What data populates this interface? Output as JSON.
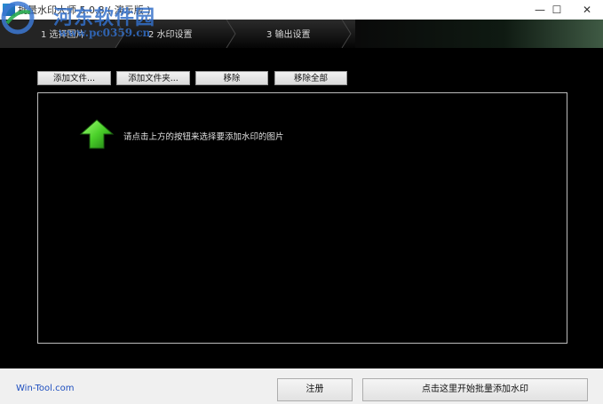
{
  "window": {
    "title": "批量水印大师 5.0.8 ( 演示版 )",
    "minimize": "—",
    "maximize": "☐",
    "close": "✕"
  },
  "watermark": {
    "line1": "河东软件园",
    "line2": "www.pc0359.cn"
  },
  "steps": [
    {
      "label": "1 选择图片"
    },
    {
      "label": "2 水印设置"
    },
    {
      "label": "3 输出设置"
    }
  ],
  "toolbar": {
    "add_files": "添加文件...",
    "add_folder": "添加文件夹...",
    "remove": "移除",
    "remove_all": "移除全部"
  },
  "droparea": {
    "hint": "请点击上方的按钮来选择要添加水印的图片",
    "icon": "green-up-arrow-icon"
  },
  "footer": {
    "link": "Win-Tool.com",
    "register": "注册",
    "start": "点击这里开始批量添加水印"
  },
  "colors": {
    "background": "#000000",
    "footer": "#f0f0f0",
    "link": "#1f4fbf",
    "arrow": "#4bd12a"
  }
}
